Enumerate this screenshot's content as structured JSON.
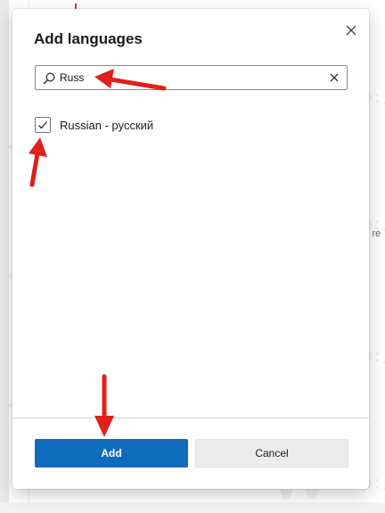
{
  "dialog": {
    "title": "Add languages",
    "search": {
      "value": "Russ",
      "placeholder": ""
    },
    "languages": [
      {
        "label": "Russian - русский",
        "checked": true
      }
    ],
    "buttons": {
      "add": "Add",
      "cancel": "Cancel"
    }
  },
  "background": {
    "snippet": "l re"
  },
  "watermark": {
    "text": "http://winaero.com",
    "short": "http:/",
    "glyph": "W"
  },
  "colors": {
    "accent": "#0f6cbd",
    "arrow": "#e0201a",
    "dialog": "#ffffff"
  },
  "icons": {
    "close": "close-icon",
    "search": "search-icon",
    "clear": "clear-icon",
    "check": "checkmark-icon",
    "arrow": "red-arrow-icon"
  }
}
